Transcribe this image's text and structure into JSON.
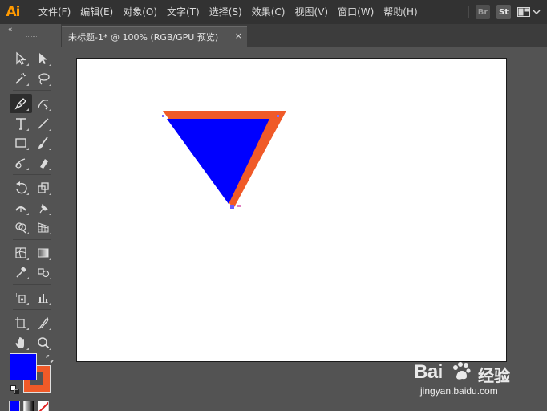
{
  "app": {
    "logo": "Ai"
  },
  "menu": {
    "items": [
      "文件(F)",
      "编辑(E)",
      "对象(O)",
      "文字(T)",
      "选择(S)",
      "效果(C)",
      "视图(V)",
      "窗口(W)",
      "帮助(H)"
    ],
    "bridge_badge": "Br",
    "stock_badge": "St"
  },
  "toolbar": {
    "collapse": "«",
    "rows": [
      [
        "selection-tool",
        "direct-selection-tool"
      ],
      [
        "magic-wand-tool",
        "lasso-tool"
      ],
      [
        "pen-tool",
        "curvature-tool"
      ],
      [
        "type-tool",
        "line-segment-tool"
      ],
      [
        "rectangle-tool",
        "paintbrush-tool"
      ],
      [
        "shaper-tool",
        "eraser-tool"
      ],
      [
        "rotate-tool",
        "scale-tool"
      ],
      [
        "width-tool",
        "puppet-warp-tool"
      ],
      [
        "shape-builder-tool",
        "perspective-grid-tool"
      ],
      [
        "mesh-tool",
        "gradient-tool"
      ],
      [
        "eyedropper-tool",
        "blend-tool"
      ],
      [
        "symbol-sprayer-tool",
        "column-graph-tool"
      ],
      [
        "artboard-tool",
        "slice-tool"
      ],
      [
        "hand-tool",
        "zoom-tool"
      ]
    ],
    "active_tool": "pen-tool"
  },
  "colors": {
    "fill": "#0000FF",
    "stroke": "#F05A28",
    "artboard": "#FFFFFF",
    "workspace": "#535353"
  },
  "document": {
    "tab_title": "未标题-1* @ 100% (RGB/GPU 预览)",
    "close": "×"
  },
  "watermark": {
    "brand": "Bai",
    "cn": "经验",
    "url": "jingyan.baidu.com"
  }
}
